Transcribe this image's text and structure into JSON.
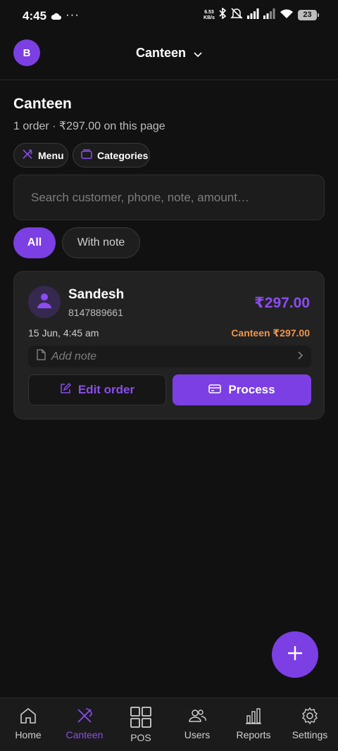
{
  "status_bar": {
    "time": "4:45",
    "net_speed_value": "6.53",
    "net_speed_unit": "KB/s",
    "battery": "23"
  },
  "header": {
    "avatar_initial": "B",
    "title": "Canteen"
  },
  "page": {
    "title": "Canteen",
    "subtitle": "1 order · ₹297.00 on this page"
  },
  "chips": {
    "menu": "Menu",
    "categories": "Categories"
  },
  "search": {
    "placeholder": "Search customer, phone, note, amount…",
    "value": ""
  },
  "filters": {
    "all": "All",
    "with_note": "With note",
    "selected": "All"
  },
  "order": {
    "customer_name": "Sandesh",
    "phone": "8147889661",
    "total": "₹297.00",
    "date": "15 Jun, 4:45 am",
    "tag": "Canteen ₹297.00",
    "note_placeholder": "Add note",
    "edit_label": "Edit order",
    "process_label": "Process"
  },
  "nav": {
    "items": [
      {
        "label": "Home",
        "icon": "home-icon"
      },
      {
        "label": "Canteen",
        "icon": "utensils-icon",
        "active": true
      },
      {
        "label": "POS",
        "icon": "grid-icon"
      },
      {
        "label": "Users",
        "icon": "users-icon"
      },
      {
        "label": "Reports",
        "icon": "bar-chart-icon"
      },
      {
        "label": "Settings",
        "icon": "gear-icon"
      }
    ]
  },
  "colors": {
    "accent": "#7b3fe4",
    "accent_text": "#8b4cf0",
    "tag_orange": "#f0954a",
    "background": "#111111",
    "card": "#222222"
  }
}
